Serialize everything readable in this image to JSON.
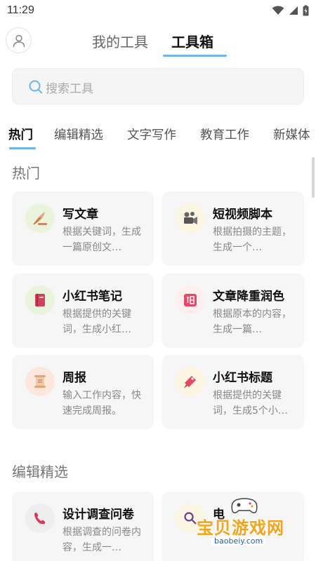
{
  "status_bar": {
    "time": "11:29"
  },
  "header": {
    "tabs": [
      {
        "label": "我的工具",
        "active": false
      },
      {
        "label": "工具箱",
        "active": true
      }
    ]
  },
  "search": {
    "placeholder": "搜索工具"
  },
  "categories": [
    "热门",
    "编辑精选",
    "文字写作",
    "教育工作",
    "新媒体"
  ],
  "sections": [
    {
      "title": "热门",
      "cards": [
        {
          "title": "写文章",
          "desc": "根据关键词，生成一篇原创文…",
          "icon": "quill-icon",
          "icon_bg": "#eaf4dc"
        },
        {
          "title": "短视频脚本",
          "desc": "根据拍摄的主题，生成一个…",
          "icon": "camera-icon",
          "icon_bg": "#fbf5e2"
        },
        {
          "title": "小红书笔记",
          "desc": "根据提供的关键词，生成小红…",
          "icon": "notebook-icon",
          "icon_bg": "#eaf4dc"
        },
        {
          "title": "文章降重润色",
          "desc": "根据原本的内容，生成一篇…",
          "icon": "polish-icon",
          "icon_bg": "#fdf0ef"
        },
        {
          "title": "周报",
          "desc": "输入工作内容，快速完成周报。",
          "icon": "scroll-icon",
          "icon_bg": "#fde6dc"
        },
        {
          "title": "小红书标题",
          "desc": "根据提供的关键词，生成5个小…",
          "icon": "bookmark-icon",
          "icon_bg": "#fbf5e2"
        }
      ]
    },
    {
      "title": "编辑精选",
      "cards": [
        {
          "title": "设计调查问卷",
          "desc": "根据调查的问卷内容，生成一…",
          "icon": "phone-icon",
          "icon_bg": "#eeeeee"
        },
        {
          "title": "电",
          "desc": "",
          "icon": "magnifier-icon",
          "icon_bg": "#fbf5e2"
        }
      ]
    }
  ],
  "watermark": {
    "text": "宝贝游戏网",
    "url": "baobeiy.com"
  }
}
